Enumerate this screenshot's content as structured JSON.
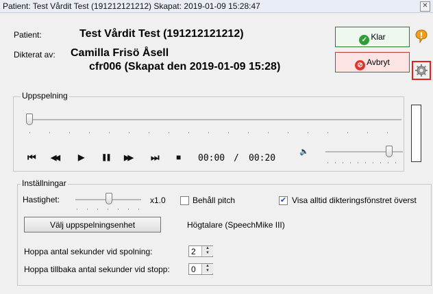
{
  "window": {
    "title": "Patient: Test Vårdit Test (191212121212) Skapat: 2019-01-09 15:28:47",
    "close_symbol": "✕"
  },
  "header": {
    "patient_label": "Patient:",
    "patient_value": "Test Vårdit Test (191212121212)",
    "dictated_by_label": "Dikterat av:",
    "dictated_by_name": "Camilla Frisö Åsell",
    "dictated_by_detail": "cfr006 (Skapat den 2019-01-09 15:28)"
  },
  "buttons": {
    "ready_label": "Klar",
    "cancel_label": "Avbryt",
    "ready_icon": "check-circle-icon",
    "cancel_icon": "prohibited-icon"
  },
  "side_icons": {
    "info_icon": "info-balloon-icon",
    "settings_icon": "gear-icon"
  },
  "playback": {
    "legend": "Uppspelning",
    "controls": [
      "skip-to-start-icon",
      "rewind-icon",
      "play-icon",
      "pause-icon",
      "fast-forward-icon",
      "skip-to-end-icon",
      "stop-icon"
    ],
    "glyphs": {
      "start": "⏮",
      "rewind": "◀◀",
      "play": "▶",
      "pause": "❚❚",
      "ff": "▶▶",
      "end": "⏭",
      "stop": "■",
      "volume": "🔈"
    },
    "current_time": "00:00",
    "separator": "/",
    "total_time": "00:20",
    "position_fraction": 0.0,
    "volume_fraction": 0.85
  },
  "settings": {
    "legend": "Inställningar",
    "speed_label": "Hastighet:",
    "speed_value": "x1.0",
    "keep_pitch_label": "Behåll pitch",
    "keep_pitch_checked": false,
    "always_on_top_label": "Visa alltid dikteringsfönstret överst",
    "always_on_top_checked": true,
    "check_mark": "✔",
    "select_device_button": "Välj uppspelningsenhet",
    "device_name": "Högtalare (SpeechMike III)",
    "skip_seconds_label": "Hoppa antal sekunder vid spolning:",
    "skip_seconds_value": "2",
    "back_seconds_label": "Hoppa tillbaka antal sekunder vid stopp:",
    "back_seconds_value": "0",
    "spin_up": "▲",
    "spin_down": "▼"
  },
  "colors": {
    "ready_green": "#2e9e3a",
    "cancel_red": "#e0342c",
    "highlight_red": "#e2211c",
    "info_orange": "#f0a020"
  }
}
